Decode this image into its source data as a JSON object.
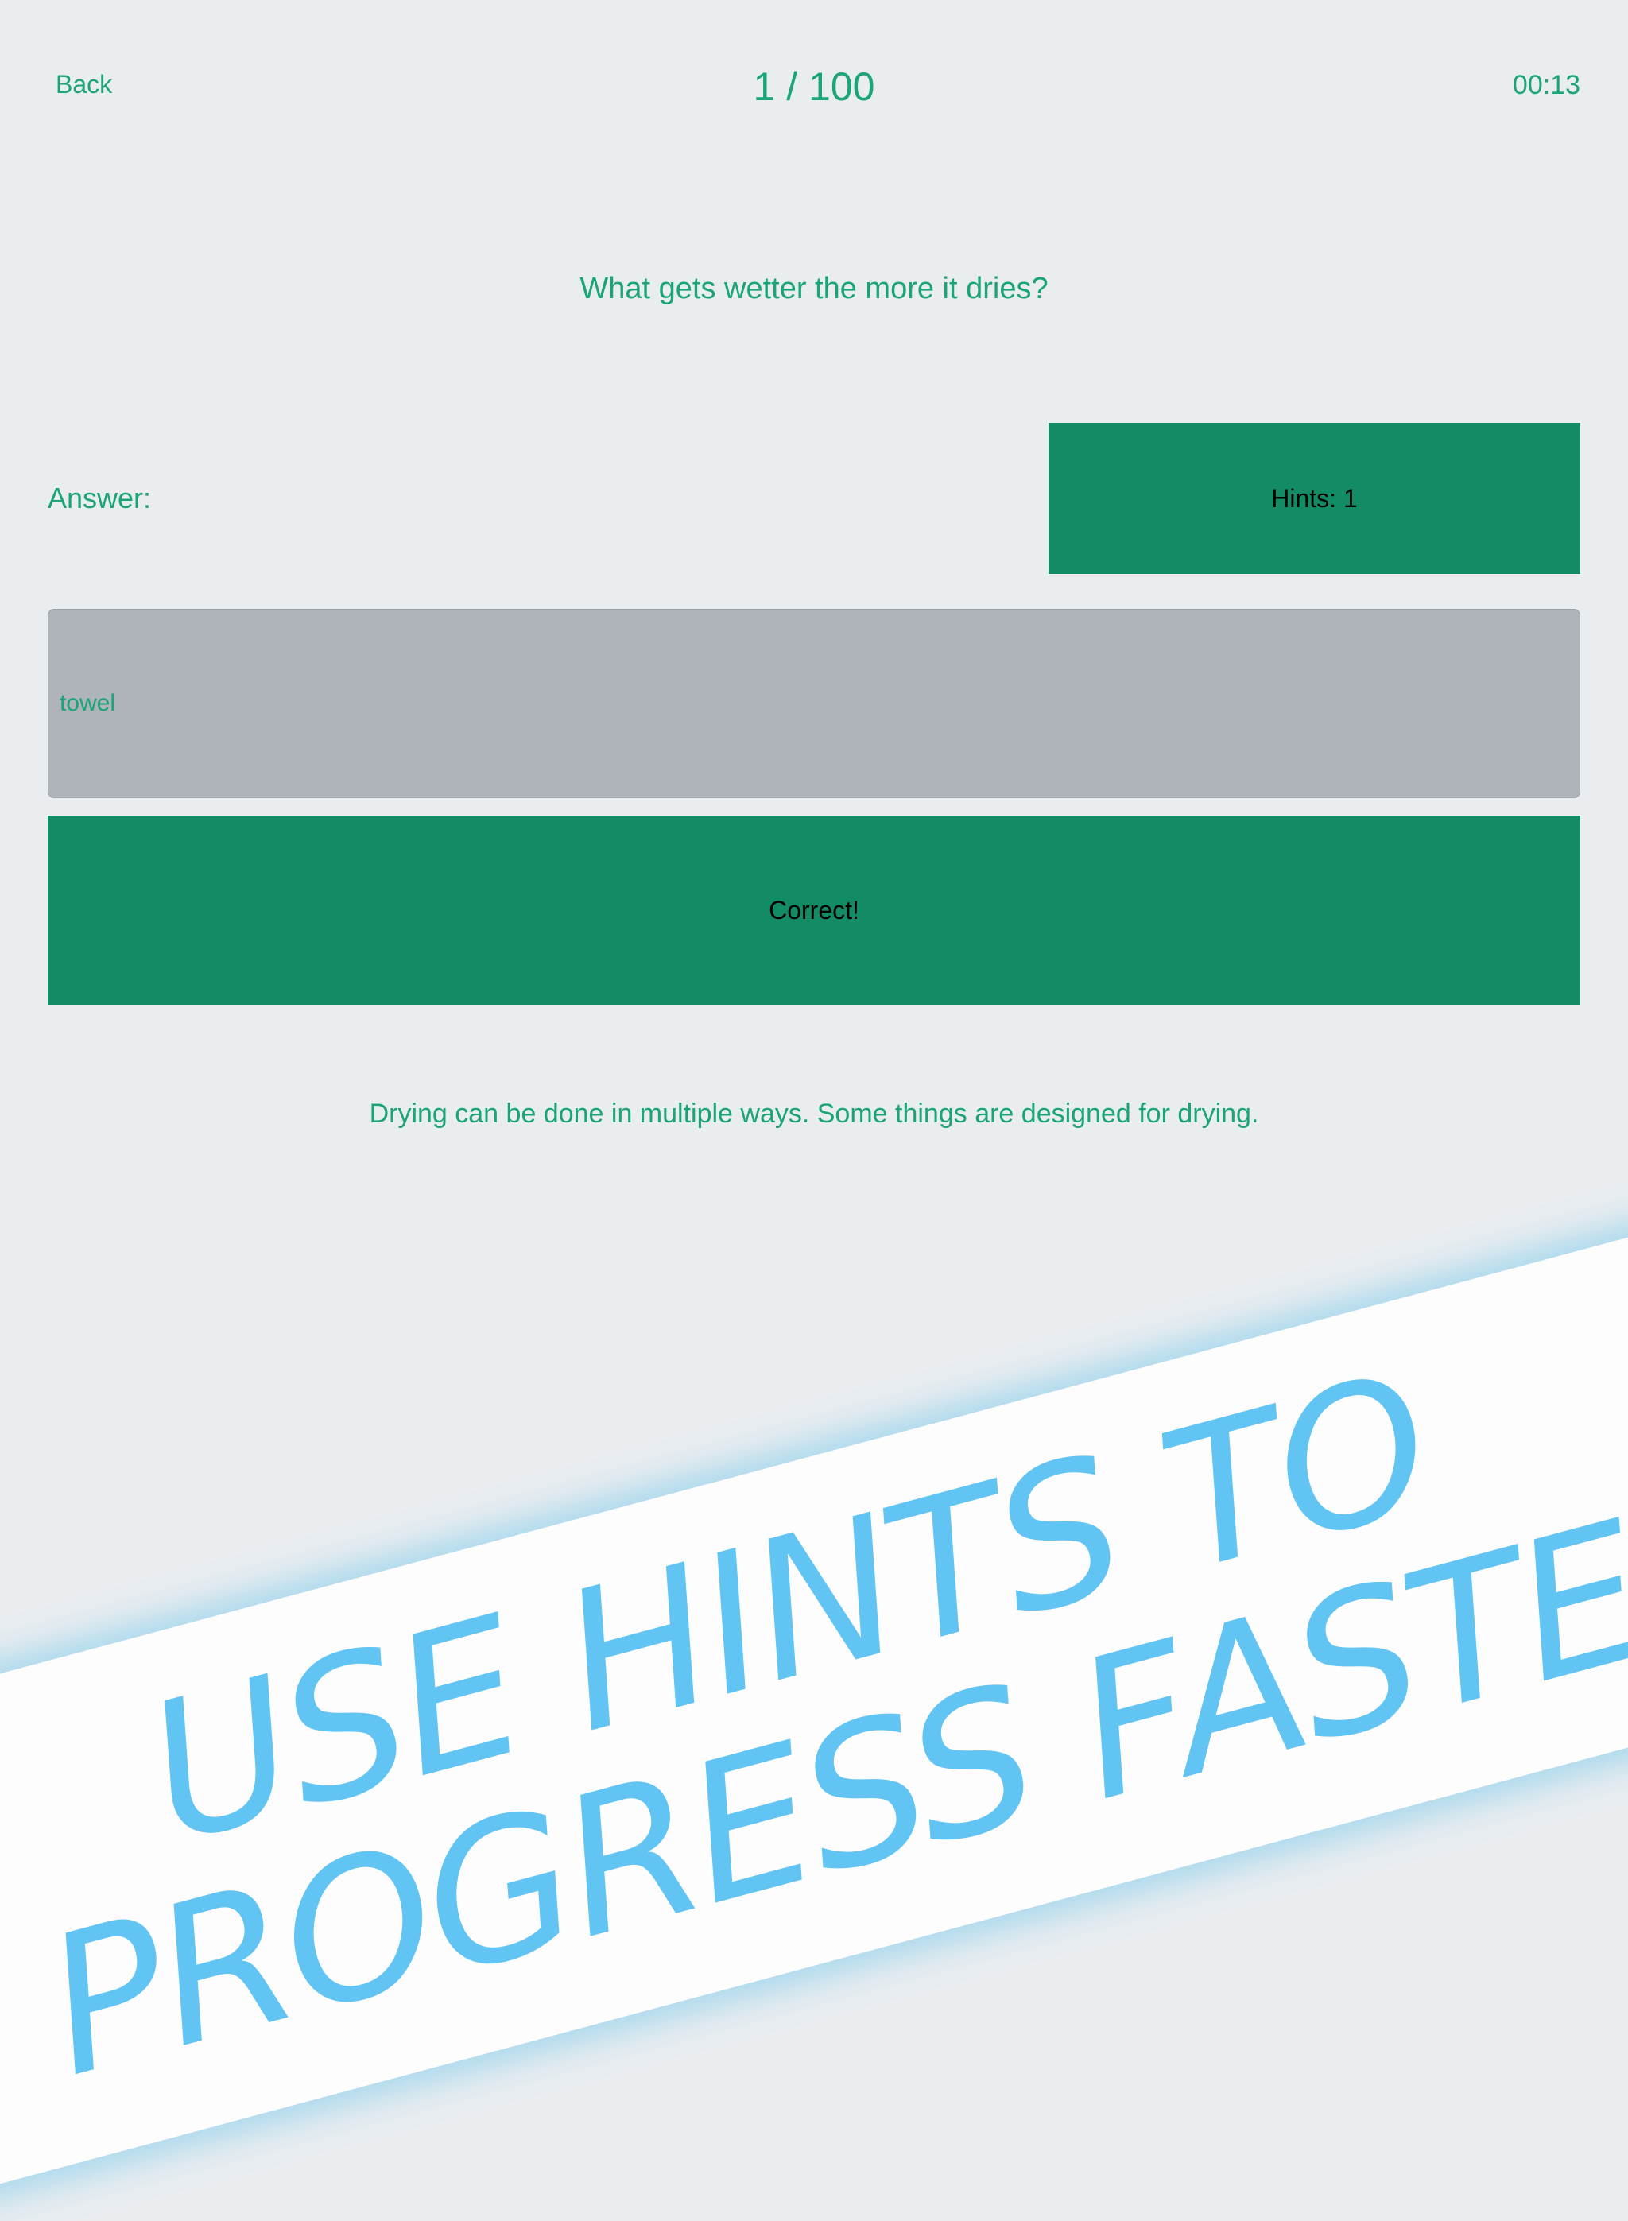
{
  "header": {
    "back_label": "Back",
    "progress": "1 / 100",
    "timer": "00:13"
  },
  "question": {
    "text": "What gets wetter the more it dries?"
  },
  "answer": {
    "label": "Answer:",
    "hints_label": "Hints: 1",
    "input_value": "towel",
    "result_label": "Correct!"
  },
  "explanation": {
    "text": "Drying can be done in multiple ways. Some things are designed for drying."
  },
  "promo": {
    "line1": "USE HINTS TO",
    "line2": "PROGRESS FASTER"
  },
  "colors": {
    "background": "#e9edf0",
    "accent_text": "#1aa477",
    "button_green": "#138b65",
    "input_gray": "#afb4bb",
    "promo_blue": "#62c4f2"
  }
}
